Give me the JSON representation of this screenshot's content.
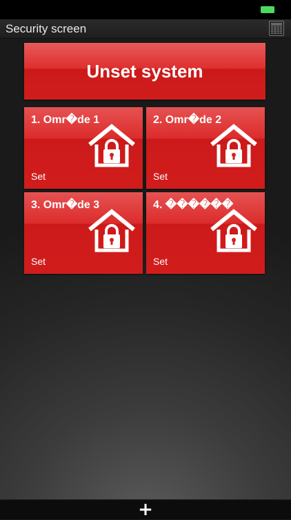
{
  "header": {
    "title": "Security screen",
    "keypad_icon": "keypad-icon"
  },
  "status_bar": {
    "battery_icon": "battery-icon"
  },
  "main": {
    "unset_label": "Unset system",
    "areas": [
      {
        "title": "1. Omr�de 1",
        "status": "Set",
        "icon": "house-lock-icon"
      },
      {
        "title": "2. Omr�de 2",
        "status": "Set",
        "icon": "house-lock-icon"
      },
      {
        "title": "3. Omr�de 3",
        "status": "Set",
        "icon": "house-lock-icon"
      },
      {
        "title": "4. ������",
        "status": "Set",
        "icon": "house-lock-icon"
      }
    ]
  },
  "footer": {
    "add_label": "+"
  },
  "colors": {
    "accent_red": "#d42020",
    "battery_green": "#4cd964"
  }
}
